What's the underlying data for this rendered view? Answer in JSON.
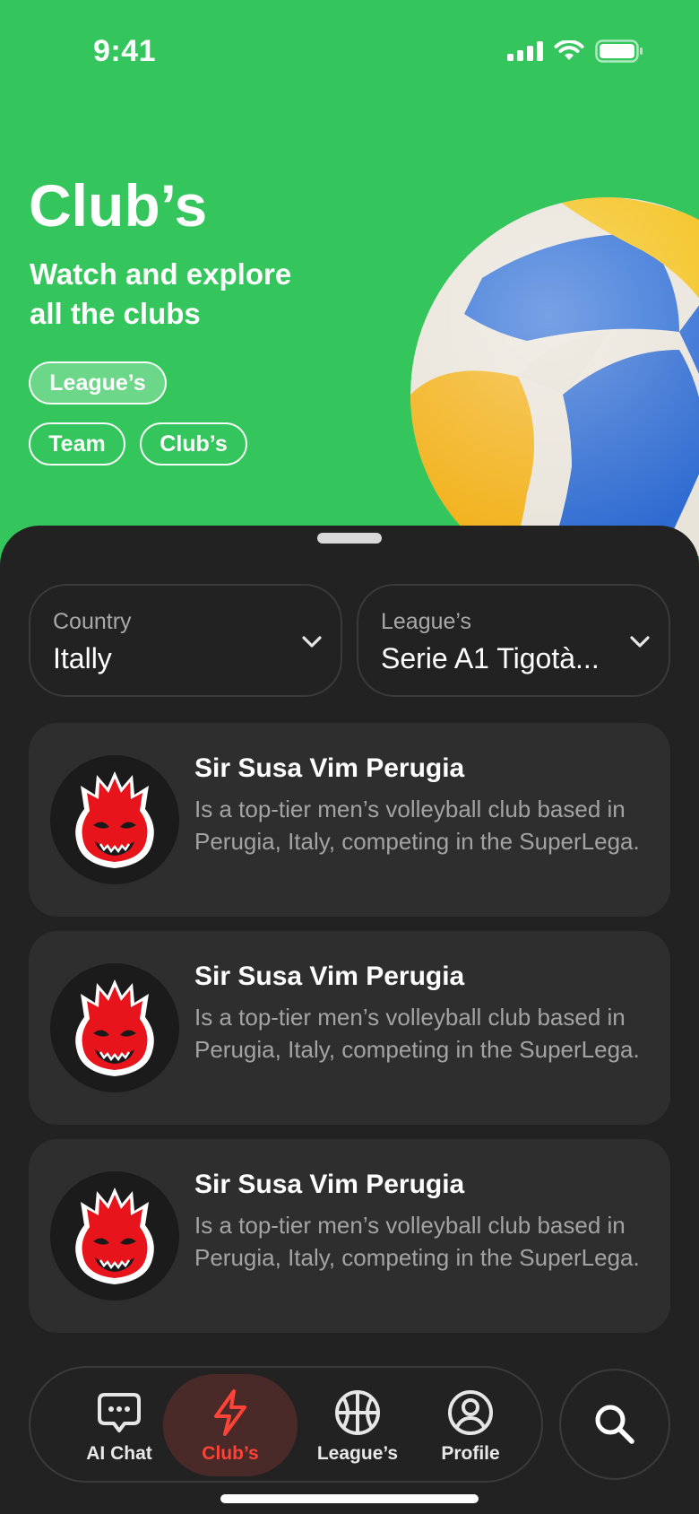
{
  "status_bar": {
    "time": "9:41"
  },
  "hero": {
    "title": "Club’s",
    "subtitle": "Watch and explore all the clubs",
    "chips": [
      {
        "label": "League’s",
        "active": true
      },
      {
        "label": "Team",
        "active": false
      },
      {
        "label": "Club’s",
        "active": false
      }
    ]
  },
  "filters": {
    "country": {
      "label": "Country",
      "value": "Itally"
    },
    "league": {
      "label": "League’s",
      "value": "Serie A1 Tigotà..."
    }
  },
  "clubs": [
    {
      "name": "Sir Susa Vim Perugia",
      "description": "Is a top-tier men’s volleyball club based in Perugia, Italy, competing in the SuperLega."
    },
    {
      "name": "Sir Susa Vim Perugia",
      "description": "Is a top-tier men’s volleyball club based in Perugia, Italy, competing in the SuperLega."
    },
    {
      "name": "Sir Susa Vim Perugia",
      "description": "Is a top-tier men’s volleyball club based in Perugia, Italy, competing in the SuperLega."
    }
  ],
  "tab_bar": {
    "tabs": [
      {
        "label": "AI Chat",
        "icon": "chat-bubble-icon",
        "active": false
      },
      {
        "label": "Club’s",
        "icon": "lightning-icon",
        "active": true
      },
      {
        "label": "League’s",
        "icon": "basketball-icon",
        "active": false
      },
      {
        "label": "Profile",
        "icon": "profile-icon",
        "active": false
      }
    ],
    "search_icon": "search-icon"
  },
  "colors": {
    "brand_green": "#34C65C",
    "sheet_bg": "#222222",
    "card_bg": "#2E2E2E",
    "accent_red": "#FF4336"
  }
}
